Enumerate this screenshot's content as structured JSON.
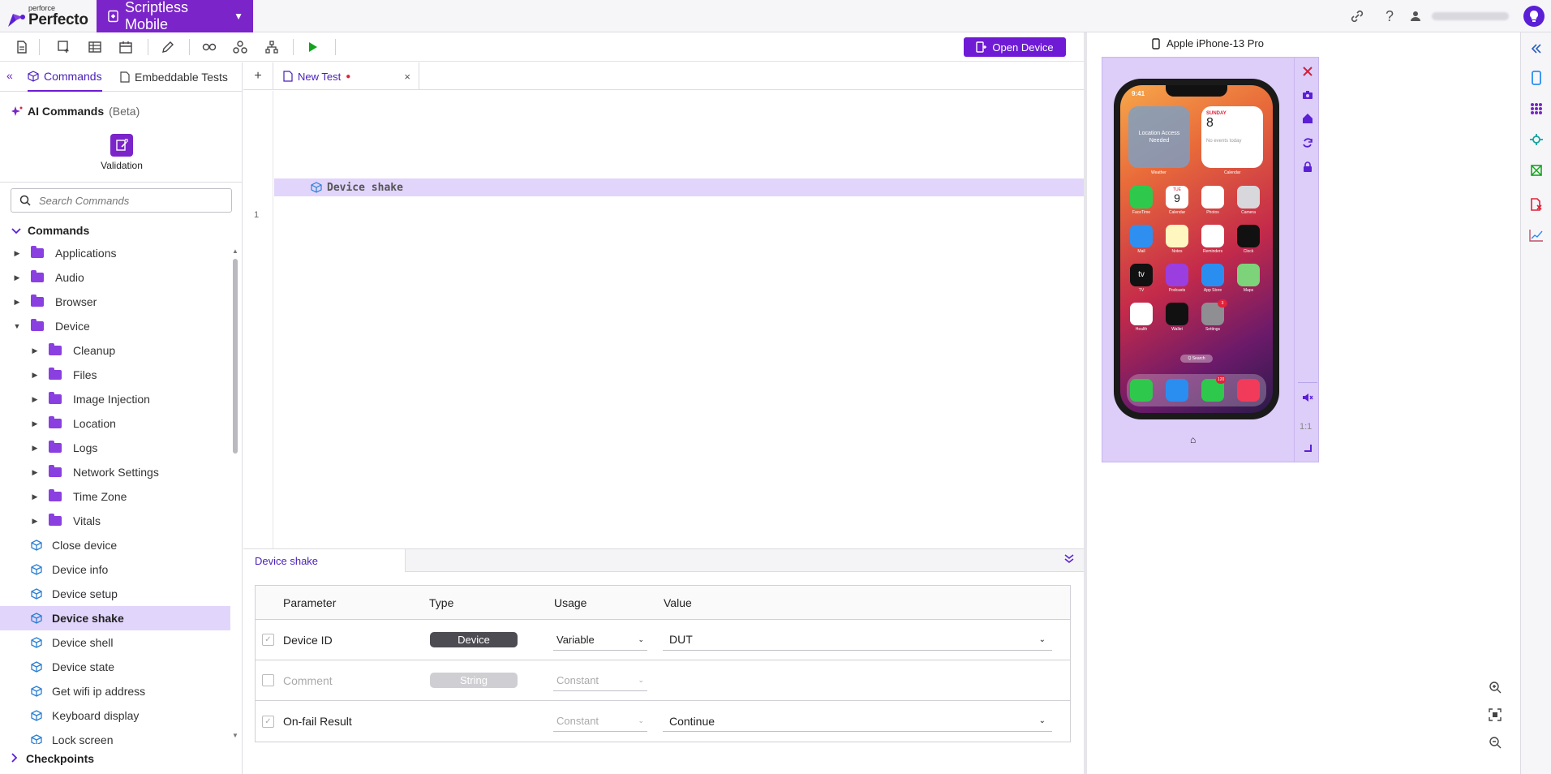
{
  "app": {
    "brand_small": "perforce",
    "brand": "Perfecto",
    "product": "Scriptless Mobile"
  },
  "toolbar": {
    "open_device_label": "Open Device"
  },
  "left_panel": {
    "tabs": [
      {
        "label": "Commands",
        "icon": "cube-icon",
        "active": true
      },
      {
        "label": "Embeddable Tests",
        "icon": "document-icon",
        "active": false
      }
    ],
    "ai_commands_title": "AI Commands",
    "ai_commands_beta": "(Beta)",
    "ai_validation_label": "Validation",
    "search_placeholder": "Search Commands",
    "tree_title": "Commands",
    "tree_items": [
      {
        "label": "Applications",
        "type": "folder",
        "level": 0,
        "expanded": false
      },
      {
        "label": "Audio",
        "type": "folder",
        "level": 0,
        "expanded": false
      },
      {
        "label": "Browser",
        "type": "folder",
        "level": 0,
        "expanded": false
      },
      {
        "label": "Device",
        "type": "folder",
        "level": 0,
        "expanded": true
      },
      {
        "label": "Cleanup",
        "type": "folder",
        "level": 1,
        "expanded": false
      },
      {
        "label": "Files",
        "type": "folder",
        "level": 1,
        "expanded": false
      },
      {
        "label": "Image Injection",
        "type": "folder",
        "level": 1,
        "expanded": false
      },
      {
        "label": "Location",
        "type": "folder",
        "level": 1,
        "expanded": false
      },
      {
        "label": "Logs",
        "type": "folder",
        "level": 1,
        "expanded": false
      },
      {
        "label": "Network Settings",
        "type": "folder",
        "level": 1,
        "expanded": false
      },
      {
        "label": "Time Zone",
        "type": "folder",
        "level": 1,
        "expanded": false
      },
      {
        "label": "Vitals",
        "type": "folder",
        "level": 1,
        "expanded": false
      },
      {
        "label": "Close device",
        "type": "command",
        "level": 1
      },
      {
        "label": "Device info",
        "type": "command",
        "level": 1
      },
      {
        "label": "Device setup",
        "type": "command",
        "level": 1
      },
      {
        "label": "Device shake",
        "type": "command",
        "level": 1,
        "selected": true
      },
      {
        "label": "Device shell",
        "type": "command",
        "level": 1
      },
      {
        "label": "Device state",
        "type": "command",
        "level": 1
      },
      {
        "label": "Get wifi ip address",
        "type": "command",
        "level": 1
      },
      {
        "label": "Keyboard display",
        "type": "command",
        "level": 1
      },
      {
        "label": "Lock screen",
        "type": "command",
        "level": 1
      }
    ],
    "checkpoints_label": "Checkpoints"
  },
  "editor": {
    "add_tab": "+",
    "tab_title": "New Test",
    "tab_modified": "●",
    "tab_close": "×",
    "line_number": "1",
    "line_text": "Device shake"
  },
  "properties": {
    "tab_title": "Device shake",
    "columns": [
      "Parameter",
      "Type",
      "Usage",
      "Value"
    ],
    "rows": [
      {
        "checked": true,
        "enabled": true,
        "parameter": "Device ID",
        "type": "Device",
        "usage": "Variable",
        "value": "DUT"
      },
      {
        "checked": false,
        "enabled": false,
        "parameter": "Comment",
        "type": "String",
        "usage": "Constant",
        "value": ""
      },
      {
        "checked": true,
        "enabled": true,
        "parameter": "On-fail Result",
        "type": "",
        "usage": "Constant",
        "value": "Continue"
      }
    ]
  },
  "device": {
    "name": "Apple iPhone-13 Pro",
    "ratio_label": "1:1",
    "screen": {
      "time": "9:41",
      "weather_widget": "Location Access Needed",
      "weather_label": "Weather",
      "calendar_day": "SUNDAY",
      "calendar_date": "8",
      "calendar_events": "No events today",
      "calendar_label": "Calendar",
      "search_label": "Q Search",
      "messages_badge": "120",
      "settings_badge": "3",
      "apps": [
        {
          "name": "FaceTime",
          "color": "#2ec94c"
        },
        {
          "name": "Calendar",
          "color": "#ffffff"
        },
        {
          "name": "Photos",
          "color": "#ffffff"
        },
        {
          "name": "Camera",
          "color": "#d8d8dc"
        },
        {
          "name": "Mail",
          "color": "#2f8ff0"
        },
        {
          "name": "Notes",
          "color": "#fff6c0"
        },
        {
          "name": "Reminders",
          "color": "#ffffff"
        },
        {
          "name": "Clock",
          "color": "#111111"
        },
        {
          "name": "TV",
          "color": "#111111"
        },
        {
          "name": "Podcasts",
          "color": "#9b3ee0"
        },
        {
          "name": "App Store",
          "color": "#2a8ef0"
        },
        {
          "name": "Maps",
          "color": "#7cd37a"
        },
        {
          "name": "Health",
          "color": "#ffffff"
        },
        {
          "name": "Wallet",
          "color": "#111111"
        },
        {
          "name": "Settings",
          "color": "#8e8e93"
        }
      ],
      "cal_icon_day": "TUE",
      "cal_icon_date": "9",
      "tv_text": "tv",
      "dock": [
        {
          "name": "Phone",
          "color": "#2ec94c"
        },
        {
          "name": "Safari",
          "color": "#2a8ef0"
        },
        {
          "name": "Messages",
          "color": "#2ec94c"
        },
        {
          "name": "Music",
          "color": "#f23b5a"
        }
      ]
    }
  },
  "colors": {
    "accent": "#6f1bd6",
    "selected_row": "#e2d5fb",
    "device_bg": "#dccdf9"
  }
}
